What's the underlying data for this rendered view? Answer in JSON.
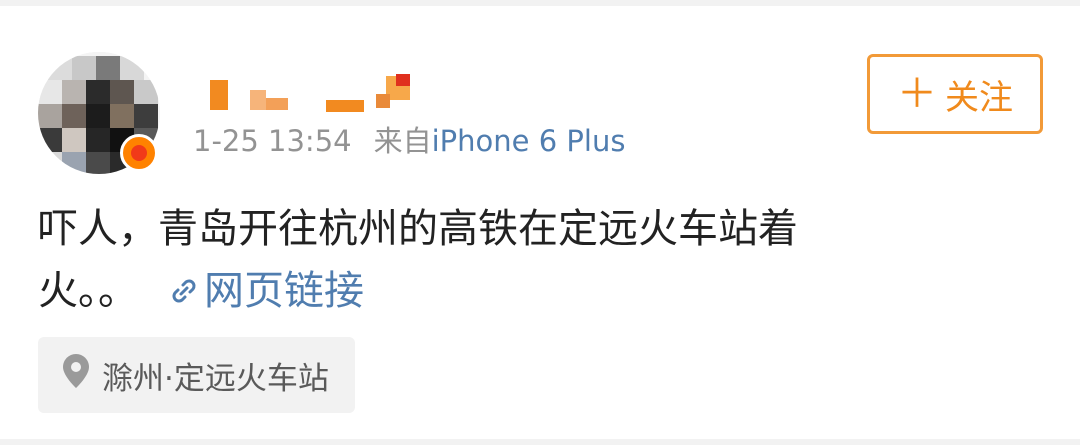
{
  "post": {
    "time": "1-25 13:54",
    "from_label": "来自",
    "device": "iPhone 6 Plus",
    "follow_label": "关注",
    "follow_icon": "plus-icon",
    "content_line1": "吓人，青岛开往杭州的高铁在定远火车站着",
    "content_line2": "火。。",
    "link_label": "网页链接",
    "link_icon": "link-icon",
    "location": "滁州·定远火车站",
    "location_icon": "location-pin-icon"
  },
  "colors": {
    "accent_orange": "#f08a1c",
    "link_blue": "#507daf",
    "meta_gray": "#939393",
    "location_bg": "#f2f2f2"
  }
}
